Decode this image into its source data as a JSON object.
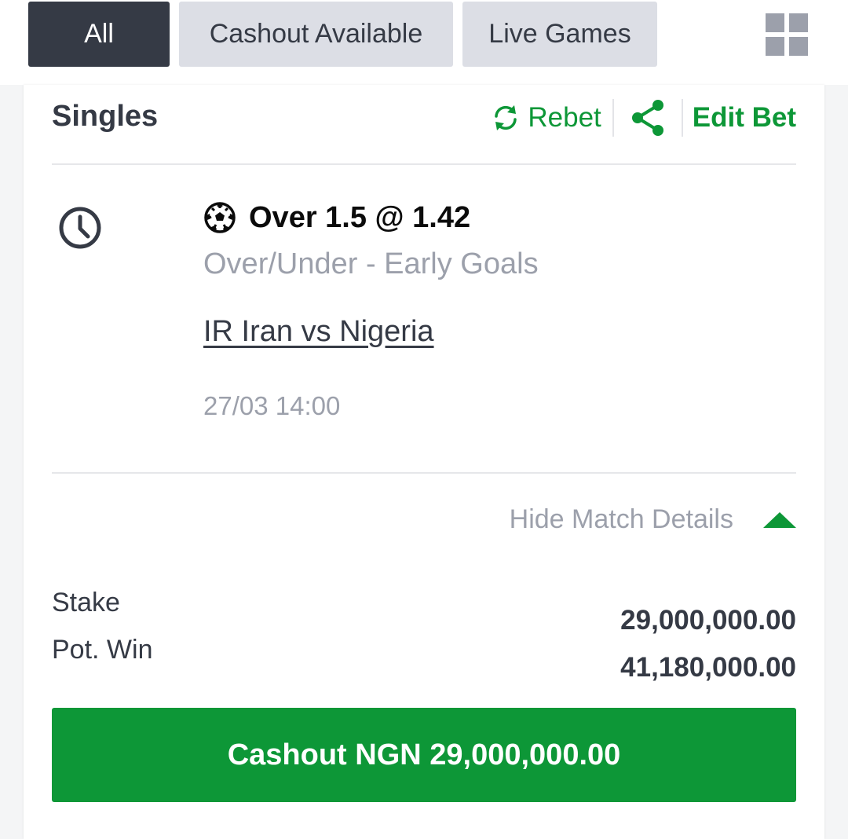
{
  "filters": {
    "all": "All",
    "cashout_available": "Cashout Available",
    "live_games": "Live Games",
    "layout_icon": "grid-icon"
  },
  "bet": {
    "type": "Singles",
    "actions": {
      "rebet": "Rebet",
      "share_icon": "share-icon",
      "edit_bet": "Edit Bet"
    },
    "selection": {
      "status_icon": "clock-icon",
      "sport_icon": "soccer-ball-icon",
      "pick": "Over 1.5 @ 1.42",
      "market": "Over/Under - Early Goals",
      "match": "IR Iran vs Nigeria",
      "kickoff": "27/03 14:00"
    },
    "toggle_details": "Hide Match Details",
    "stake_label": "Stake",
    "pot_win_label": "Pot. Win",
    "stake_value": "29,000,000.00",
    "pot_win_value": "41,180,000.00",
    "cashout_button": "Cashout NGN 29,000,000.00"
  },
  "colors": {
    "accent_green": "#0d9737",
    "dark": "#353a45",
    "muted": "#9ca0ab",
    "chip_bg": "#dcdee5"
  }
}
